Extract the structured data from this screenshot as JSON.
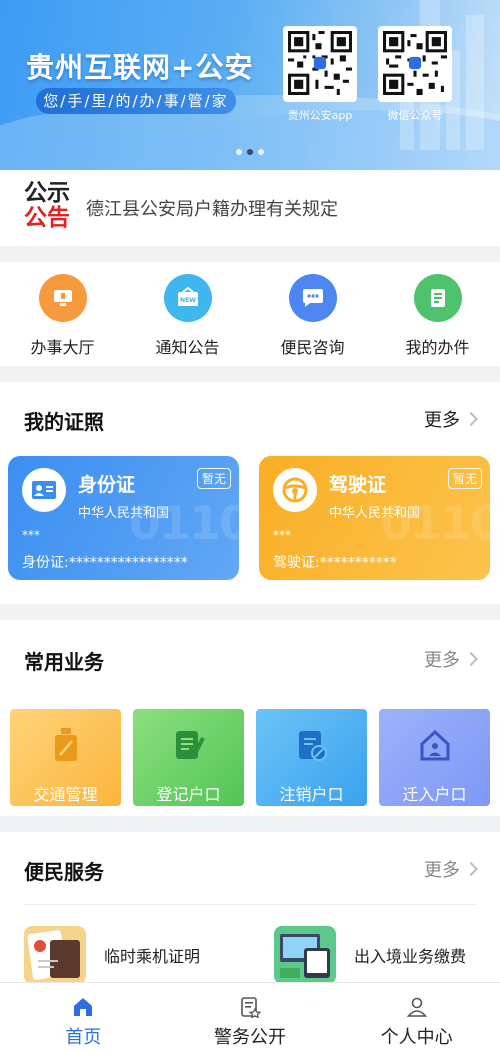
{
  "banner": {
    "title": "贵州互联网+公安",
    "slogan": "您/手/里/的/办/事/管/家",
    "qr_items": [
      {
        "label": "贵州公安app"
      },
      {
        "label": "微信公众号"
      }
    ],
    "carousel_active_index": 1
  },
  "notice": {
    "logo_line1": "公示",
    "logo_line2": "公告",
    "text": "德江县公安局户籍办理有关规定"
  },
  "quick_actions": [
    {
      "label": "办事大厅",
      "icon": "monitor-icon",
      "color": "#f79a3e"
    },
    {
      "label": "通知公告",
      "icon": "new-board-icon",
      "color": "#3fb6ee"
    },
    {
      "label": "便民咨询",
      "icon": "chat-icon",
      "color": "#4d86f0"
    },
    {
      "label": "我的办件",
      "icon": "document-icon",
      "color": "#4fc26d"
    }
  ],
  "my_licenses": {
    "title": "我的证照",
    "more": "更多",
    "cards": [
      {
        "name": "身份证",
        "subtitle": "中华人民共和国",
        "badge": "暂无",
        "stars": "***",
        "number": "身份证:*****************",
        "icon": "id-card-icon"
      },
      {
        "name": "驾驶证",
        "subtitle": "中华人民共和国",
        "badge": "暂无",
        "stars": "***",
        "number": "驾驶证:***********",
        "icon": "steering-wheel-icon"
      }
    ]
  },
  "common_business": {
    "title": "常用业务",
    "more": "更多",
    "items": [
      {
        "label": "交通管理",
        "icon": "traffic-icon"
      },
      {
        "label": "登记户口",
        "icon": "register-icon"
      },
      {
        "label": "注销户口",
        "icon": "cancel-registration-icon"
      },
      {
        "label": "迁入户口",
        "icon": "move-in-icon"
      }
    ]
  },
  "convenience": {
    "title": "便民服务",
    "more": "更多",
    "items": [
      {
        "label": "临时乘机证明",
        "icon": "flight-certificate-icon"
      },
      {
        "label": "出入境业务缴费",
        "icon": "payment-icon"
      }
    ]
  },
  "tabbar": {
    "tabs": [
      {
        "label": "首页",
        "icon": "home-icon"
      },
      {
        "label": "警务公开",
        "icon": "police-affairs-icon"
      },
      {
        "label": "个人中心",
        "icon": "user-icon"
      }
    ],
    "active_index": 0
  }
}
